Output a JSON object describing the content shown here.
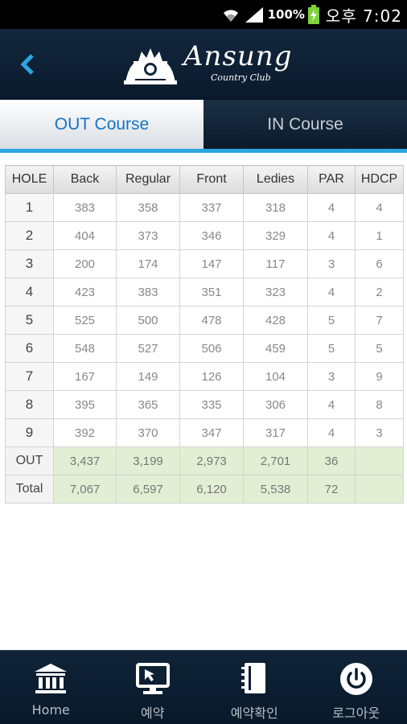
{
  "status_bar": {
    "battery_percent": "100%",
    "clock": "오후 7:02"
  },
  "header": {
    "logo_name": "Ansung",
    "logo_sub": "Country Club"
  },
  "tabs": [
    {
      "label": "OUT Course",
      "active": true
    },
    {
      "label": "IN Course",
      "active": false
    }
  ],
  "table": {
    "columns": [
      "HOLE",
      "Back",
      "Regular",
      "Front",
      "Ledies",
      "PAR",
      "HDCP"
    ],
    "rows": [
      [
        "1",
        "383",
        "358",
        "337",
        "318",
        "4",
        "4"
      ],
      [
        "2",
        "404",
        "373",
        "346",
        "329",
        "4",
        "1"
      ],
      [
        "3",
        "200",
        "174",
        "147",
        "117",
        "3",
        "6"
      ],
      [
        "4",
        "423",
        "383",
        "351",
        "323",
        "4",
        "2"
      ],
      [
        "5",
        "525",
        "500",
        "478",
        "428",
        "5",
        "7"
      ],
      [
        "6",
        "548",
        "527",
        "506",
        "459",
        "5",
        "5"
      ],
      [
        "7",
        "167",
        "149",
        "126",
        "104",
        "3",
        "9"
      ],
      [
        "8",
        "395",
        "365",
        "335",
        "306",
        "4",
        "8"
      ],
      [
        "9",
        "392",
        "370",
        "347",
        "317",
        "4",
        "3"
      ]
    ],
    "summary_rows": [
      [
        "OUT",
        "3,437",
        "3,199",
        "2,973",
        "2,701",
        "36",
        ""
      ],
      [
        "Total",
        "7,067",
        "6,597",
        "6,120",
        "5,538",
        "72",
        ""
      ]
    ]
  },
  "bottom_nav": [
    {
      "label": "Home",
      "icon": "bank-icon"
    },
    {
      "label": "예약",
      "icon": "monitor-cursor-icon"
    },
    {
      "label": "예약확인",
      "icon": "notebook-icon"
    },
    {
      "label": "로그아웃",
      "icon": "power-icon"
    }
  ],
  "colors": {
    "accent": "#2aa7e0",
    "active_tab_text": "#1673c5",
    "summary_row_bg": "#e2efd4",
    "header_bg": "#0f2236"
  }
}
